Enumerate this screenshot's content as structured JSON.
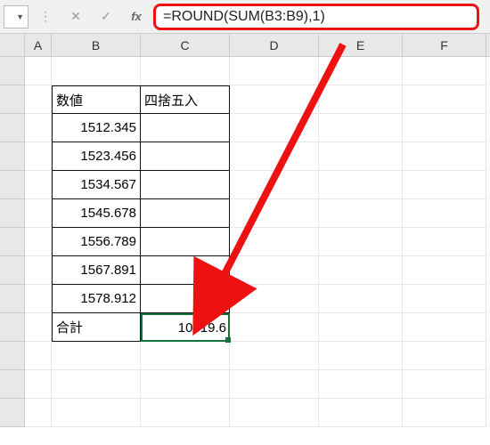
{
  "formula_bar": {
    "fx_label": "fx",
    "formula": "=ROUND(SUM(B3:B9),1)"
  },
  "columns": [
    "A",
    "B",
    "C",
    "D",
    "E",
    "F"
  ],
  "table": {
    "headers": {
      "b": "数値",
      "c": "四捨五入"
    },
    "rows": [
      {
        "b": "1512.345",
        "c": ""
      },
      {
        "b": "1523.456",
        "c": ""
      },
      {
        "b": "1534.567",
        "c": ""
      },
      {
        "b": "1545.678",
        "c": ""
      },
      {
        "b": "1556.789",
        "c": ""
      },
      {
        "b": "1567.891",
        "c": ""
      },
      {
        "b": "1578.912",
        "c": ""
      }
    ],
    "footer": {
      "b": "合計",
      "c": "10819.6"
    }
  },
  "annotations": {
    "arrow_color": "#e11"
  }
}
